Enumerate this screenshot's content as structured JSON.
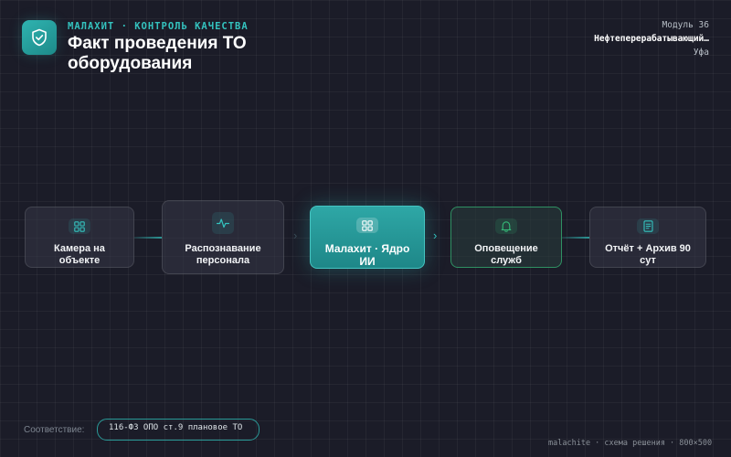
{
  "header": {
    "eyebrow": "МАЛАХИТ · КОНТРОЛЬ КАЧЕСТВА",
    "title": "Факт проведения ТО оборудования",
    "module": "Модуль 36",
    "facility": "Нефтеперерабатывающий…",
    "city": "Уфа"
  },
  "flow": {
    "nodes": [
      {
        "label": "Камера на объекте",
        "icon": "grid-icon"
      },
      {
        "label": "Распознавание персонала",
        "icon": "pulse-icon"
      },
      {
        "label": "Малахит · Ядро ИИ",
        "icon": "grid-icon"
      },
      {
        "label": "Оповещение служб",
        "icon": "bell-icon"
      },
      {
        "label": "Отчёт + Архив 90 сут",
        "icon": "document-icon"
      }
    ]
  },
  "compliance": {
    "label": "Соответствие:",
    "value": "116-ФЗ ОПО ст.9 плановое ТО"
  },
  "footer": {
    "text": "malachite · схема решения · 800×500"
  },
  "colors": {
    "accent": "#2fb3b0",
    "notify": "#35ba78",
    "background": "#1b1c28"
  }
}
